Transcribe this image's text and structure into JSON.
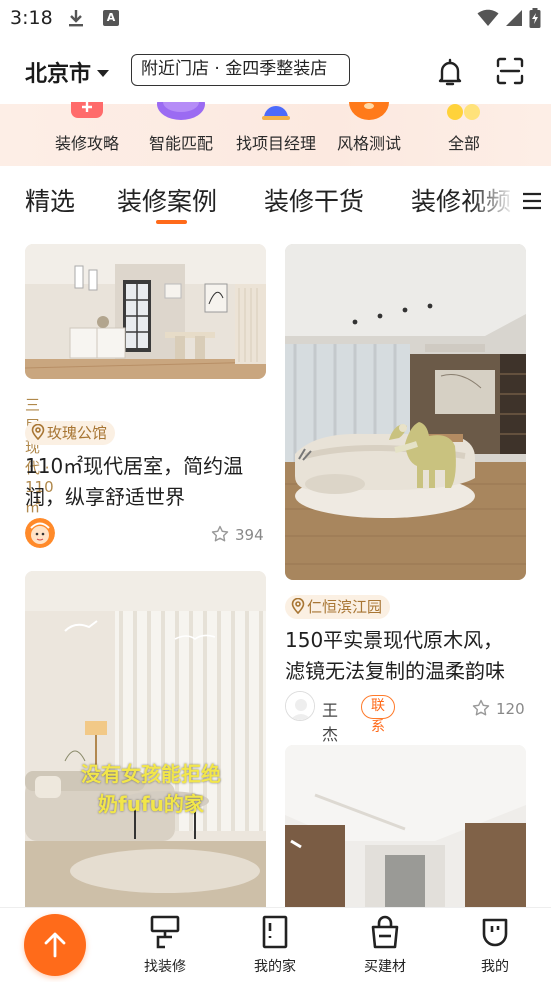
{
  "status": {
    "time": "3:18",
    "icons": [
      "download-icon",
      "a-icon",
      "wifi-icon",
      "signal-icon",
      "battery-icon"
    ]
  },
  "header": {
    "city": "北京市",
    "store_info": "附近门店 · 金四季整装店",
    "icons": [
      "bell-icon",
      "scan-icon"
    ]
  },
  "categories": [
    {
      "label": "装修攻略",
      "icon": "guide-icon"
    },
    {
      "label": "智能匹配",
      "icon": "match-icon"
    },
    {
      "label": "找项目经理",
      "icon": "manager-icon"
    },
    {
      "label": "风格测试",
      "icon": "style-test-icon"
    },
    {
      "label": "全部",
      "icon": "all-icon"
    }
  ],
  "tabs": [
    {
      "label": "精选"
    },
    {
      "label": "装修案例"
    },
    {
      "label": "装修干货"
    },
    {
      "label": "装修视频"
    }
  ],
  "active_tab": "装修案例",
  "cards": {
    "left1": {
      "meta": "三居 · 现代 · 110㎡",
      "location": "玫瑰公馆",
      "title_line1": "110㎡现代居室，简约温",
      "title_line2": "润，纵享舒适世界",
      "likes": "394"
    },
    "left2": {
      "overlay_text_line1": "没有女孩能拒绝",
      "overlay_text_line2": "奶fufu的家"
    },
    "right1": {
      "location": "仁恒滨江园",
      "title_line1": "150平实景现代原木风，",
      "title_line2": "滤镜无法复制的温柔韵味",
      "author": "王杰",
      "contact": "联系",
      "likes": "120"
    }
  },
  "bottom_nav": [
    {
      "label": "找装修",
      "icon": "find-decor-icon"
    },
    {
      "label": "我的家",
      "icon": "my-home-icon"
    },
    {
      "label": "买建材",
      "icon": "shopping-bag-icon"
    },
    {
      "label": "我的",
      "icon": "profile-icon"
    }
  ],
  "colors": {
    "accent": "#ff6a1a",
    "meta_text": "#b0884b",
    "tag_bg": "#fbf0e3",
    "category_bg": "#fdeee6"
  }
}
